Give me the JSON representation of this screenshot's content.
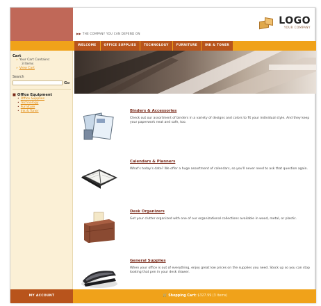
{
  "header": {
    "tagline": "THE COMPANY YOU CAN DEPEND ON",
    "logo_text": "LOGO",
    "logo_sub": "YOUR COMPANY"
  },
  "nav": {
    "tabs": [
      "WELCOME",
      "OFFICE SUPPLIES",
      "TECHNOLOGY",
      "FURNITURE",
      "INK & TONER"
    ]
  },
  "sidebar": {
    "cart_title": "Cart",
    "cart_contains": "Your Cart Contains:",
    "cart_items": "3 Items",
    "view_cart": "View Cart",
    "search_label": "Search",
    "search_go": "Go",
    "category_title": "Office Equipment",
    "category_items": [
      "Office Supplies",
      "Technology",
      "Furniture",
      "Ink & Toner"
    ]
  },
  "products": [
    {
      "title": "Binders & Accessories",
      "desc": "Check out our assortment of binders in a variety of designs and colors to fit your individual style. And they keep your paperwork neat and safe, too."
    },
    {
      "title": "Calendars & Planners",
      "desc": "What's today's date? We offer a huge assortment of calendars, so you'll never need to ask that question again."
    },
    {
      "title": "Desk Organizers",
      "desc": "Get your clutter organized with one of our organizational collections available in wood, metal, or plastic."
    },
    {
      "title": "General Supplies",
      "desc": "When your office is out of everything, enjoy great low prices on the supplies you need. Stock up so you can stop looking that pen in your desk drawer."
    }
  ],
  "footer": {
    "account": "MY ACCOUNT",
    "cart_label": "Shopping Cart:",
    "cart_amount": "$327.99 (3 items)"
  },
  "colors": {
    "accent": "#f0a21a",
    "tab_bg": "#b8541c",
    "brand_block": "#c06858",
    "sidebar_bg": "#fbf0d6",
    "link": "#e08a10",
    "title_link": "#7a2a1a"
  }
}
